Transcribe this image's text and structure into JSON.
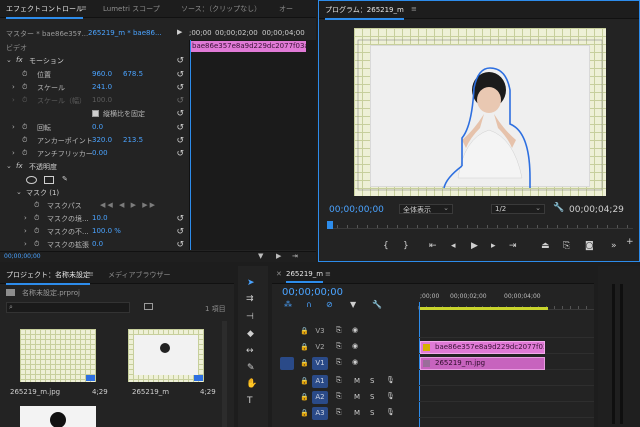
{
  "effect_controls": {
    "tabs": [
      "エフェクトコントロール",
      "Lumetri スコープ",
      "ソース：（クリップなし）",
      "オー"
    ],
    "master_label": "マスター * bae86e357...",
    "clip_label": "265219_m * bae86...",
    "timecodes": [
      ";00;00",
      "00;00;02;00",
      "00;00;04;00"
    ],
    "clip_bar_label": "bae86e357e8a9d229dc2077f03ada9a",
    "section": "ビデオ",
    "motion": "モーション",
    "position_label": "位置",
    "position_x": "960.0",
    "position_y": "678.5",
    "scale_label": "スケール",
    "scale_value": "241.0",
    "scale_w_label": "スケール（幅）",
    "scale_w_value": "100.0",
    "uniform_scale": "縦横比を固定",
    "rotation_label": "回転",
    "rotation_value": "0.0",
    "anchor_label": "アンカーポイント",
    "anchor_x": "320.0",
    "anchor_y": "213.5",
    "antiflicker_label": "アンチフリッカー",
    "antiflicker_value": "0.00",
    "opacity_label": "不透明度",
    "mask_label": "マスク (1)",
    "mask_path_label": "マスクパス",
    "mask_feather_label": "マスクの境...",
    "mask_feather_value": "10.0",
    "mask_opacity_label": "マスクの不...",
    "mask_opacity_value": "100.0 %",
    "mask_expansion_label": "マスクの拡張",
    "mask_expansion_value": "0.0",
    "bottom_timecode": "00;00;00;00"
  },
  "program": {
    "title": "プログラム：265219_m",
    "timecode_left": "00;00;00;00",
    "zoom": "全体表示",
    "quality": "1/2",
    "timecode_right": "00;00;04;29"
  },
  "project": {
    "tabs": [
      "プロジェクト：名称未設定",
      "メディアブラウザー"
    ],
    "filename": "名称未設定.prproj",
    "item_count": "1 項目",
    "items": [
      {
        "name": "265219_m.jpg",
        "duration": "4;29"
      },
      {
        "name": "265219_m",
        "duration": "4;29"
      }
    ]
  },
  "timeline": {
    "tab": "265219_m",
    "timecode": "00;00;00;00",
    "ruler": [
      ";00;00",
      "00;00;02;00",
      "00;00;04;00"
    ],
    "tracks": [
      "V3",
      "V2",
      "V1",
      "A1",
      "A2",
      "A3"
    ],
    "clip_v2": "bae86e357e8a9d229dc2077f038d",
    "clip_v1": "265219_m.jpg",
    "m_label": "M",
    "s_label": "S"
  },
  "colors": {
    "accent": "#2d8ceb",
    "clip_pink": "#e07ad6",
    "clip_pink_dark": "#c763be",
    "timecode_blue": "#4aa3ff"
  }
}
